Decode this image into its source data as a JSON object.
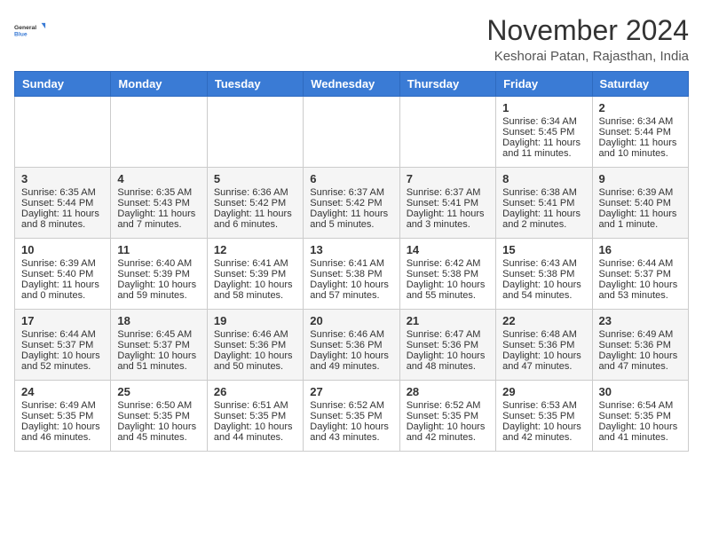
{
  "header": {
    "logo_general": "General",
    "logo_blue": "Blue",
    "month_title": "November 2024",
    "location": "Keshorai Patan, Rajasthan, India"
  },
  "weekdays": [
    "Sunday",
    "Monday",
    "Tuesday",
    "Wednesday",
    "Thursday",
    "Friday",
    "Saturday"
  ],
  "weeks": [
    [
      {
        "day": "",
        "content": ""
      },
      {
        "day": "",
        "content": ""
      },
      {
        "day": "",
        "content": ""
      },
      {
        "day": "",
        "content": ""
      },
      {
        "day": "",
        "content": ""
      },
      {
        "day": "1",
        "content": "Sunrise: 6:34 AM\nSunset: 5:45 PM\nDaylight: 11 hours and 11 minutes."
      },
      {
        "day": "2",
        "content": "Sunrise: 6:34 AM\nSunset: 5:44 PM\nDaylight: 11 hours and 10 minutes."
      }
    ],
    [
      {
        "day": "3",
        "content": "Sunrise: 6:35 AM\nSunset: 5:44 PM\nDaylight: 11 hours and 8 minutes."
      },
      {
        "day": "4",
        "content": "Sunrise: 6:35 AM\nSunset: 5:43 PM\nDaylight: 11 hours and 7 minutes."
      },
      {
        "day": "5",
        "content": "Sunrise: 6:36 AM\nSunset: 5:42 PM\nDaylight: 11 hours and 6 minutes."
      },
      {
        "day": "6",
        "content": "Sunrise: 6:37 AM\nSunset: 5:42 PM\nDaylight: 11 hours and 5 minutes."
      },
      {
        "day": "7",
        "content": "Sunrise: 6:37 AM\nSunset: 5:41 PM\nDaylight: 11 hours and 3 minutes."
      },
      {
        "day": "8",
        "content": "Sunrise: 6:38 AM\nSunset: 5:41 PM\nDaylight: 11 hours and 2 minutes."
      },
      {
        "day": "9",
        "content": "Sunrise: 6:39 AM\nSunset: 5:40 PM\nDaylight: 11 hours and 1 minute."
      }
    ],
    [
      {
        "day": "10",
        "content": "Sunrise: 6:39 AM\nSunset: 5:40 PM\nDaylight: 11 hours and 0 minutes."
      },
      {
        "day": "11",
        "content": "Sunrise: 6:40 AM\nSunset: 5:39 PM\nDaylight: 10 hours and 59 minutes."
      },
      {
        "day": "12",
        "content": "Sunrise: 6:41 AM\nSunset: 5:39 PM\nDaylight: 10 hours and 58 minutes."
      },
      {
        "day": "13",
        "content": "Sunrise: 6:41 AM\nSunset: 5:38 PM\nDaylight: 10 hours and 57 minutes."
      },
      {
        "day": "14",
        "content": "Sunrise: 6:42 AM\nSunset: 5:38 PM\nDaylight: 10 hours and 55 minutes."
      },
      {
        "day": "15",
        "content": "Sunrise: 6:43 AM\nSunset: 5:38 PM\nDaylight: 10 hours and 54 minutes."
      },
      {
        "day": "16",
        "content": "Sunrise: 6:44 AM\nSunset: 5:37 PM\nDaylight: 10 hours and 53 minutes."
      }
    ],
    [
      {
        "day": "17",
        "content": "Sunrise: 6:44 AM\nSunset: 5:37 PM\nDaylight: 10 hours and 52 minutes."
      },
      {
        "day": "18",
        "content": "Sunrise: 6:45 AM\nSunset: 5:37 PM\nDaylight: 10 hours and 51 minutes."
      },
      {
        "day": "19",
        "content": "Sunrise: 6:46 AM\nSunset: 5:36 PM\nDaylight: 10 hours and 50 minutes."
      },
      {
        "day": "20",
        "content": "Sunrise: 6:46 AM\nSunset: 5:36 PM\nDaylight: 10 hours and 49 minutes."
      },
      {
        "day": "21",
        "content": "Sunrise: 6:47 AM\nSunset: 5:36 PM\nDaylight: 10 hours and 48 minutes."
      },
      {
        "day": "22",
        "content": "Sunrise: 6:48 AM\nSunset: 5:36 PM\nDaylight: 10 hours and 47 minutes."
      },
      {
        "day": "23",
        "content": "Sunrise: 6:49 AM\nSunset: 5:36 PM\nDaylight: 10 hours and 47 minutes."
      }
    ],
    [
      {
        "day": "24",
        "content": "Sunrise: 6:49 AM\nSunset: 5:35 PM\nDaylight: 10 hours and 46 minutes."
      },
      {
        "day": "25",
        "content": "Sunrise: 6:50 AM\nSunset: 5:35 PM\nDaylight: 10 hours and 45 minutes."
      },
      {
        "day": "26",
        "content": "Sunrise: 6:51 AM\nSunset: 5:35 PM\nDaylight: 10 hours and 44 minutes."
      },
      {
        "day": "27",
        "content": "Sunrise: 6:52 AM\nSunset: 5:35 PM\nDaylight: 10 hours and 43 minutes."
      },
      {
        "day": "28",
        "content": "Sunrise: 6:52 AM\nSunset: 5:35 PM\nDaylight: 10 hours and 42 minutes."
      },
      {
        "day": "29",
        "content": "Sunrise: 6:53 AM\nSunset: 5:35 PM\nDaylight: 10 hours and 42 minutes."
      },
      {
        "day": "30",
        "content": "Sunrise: 6:54 AM\nSunset: 5:35 PM\nDaylight: 10 hours and 41 minutes."
      }
    ]
  ]
}
